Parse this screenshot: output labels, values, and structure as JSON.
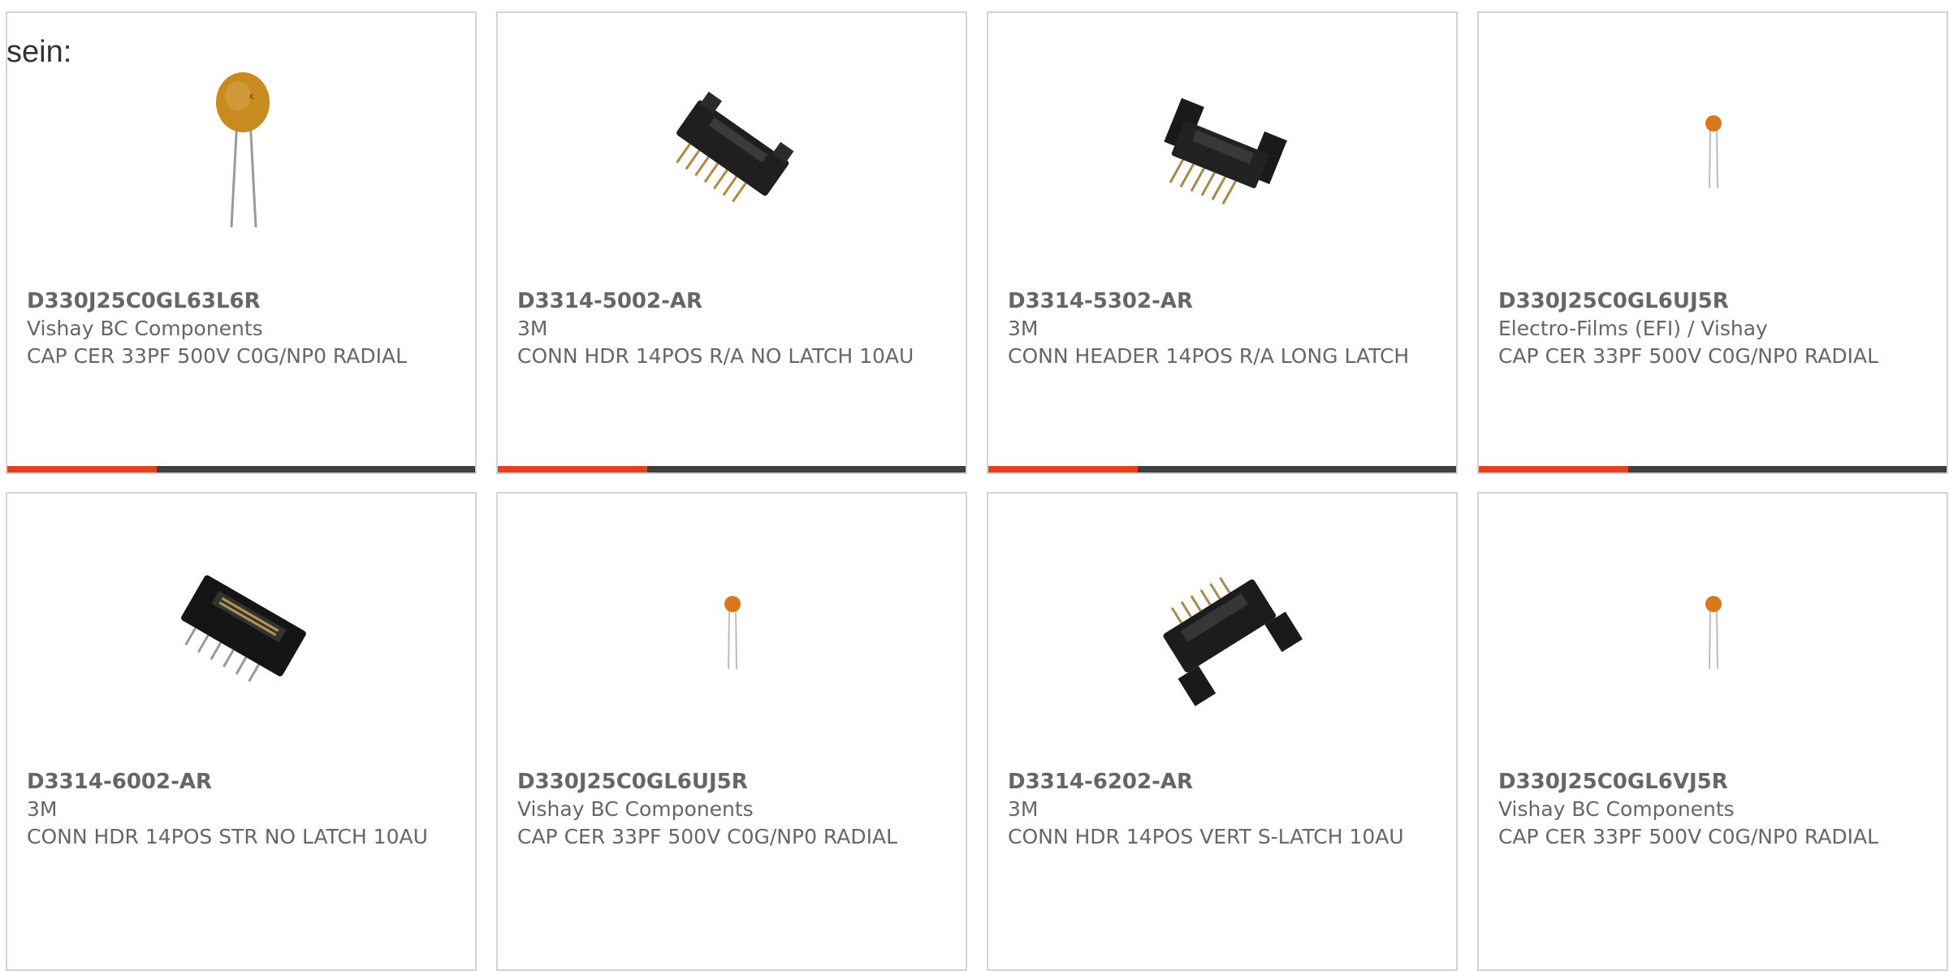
{
  "intro_text": "sein:",
  "colors": {
    "accent": "#e5411d",
    "bar": "#3f3f3f",
    "border": "#d4d4d4",
    "text": "#666666"
  },
  "products": [
    {
      "part_number": "D330J25C0GL63L6R",
      "manufacturer": "Vishay BC Components",
      "description": "CAP CER 33PF 500V C0G/NP0 RADIAL",
      "image": "ceramic-disc-capacitor-icon",
      "accent_fraction": 0.32
    },
    {
      "part_number": "D3314-5002-AR",
      "manufacturer": "3M",
      "description": "CONN HDR 14POS R/A NO LATCH 10AU",
      "image": "right-angle-header-icon",
      "accent_fraction": 0.32
    },
    {
      "part_number": "D3314-5302-AR",
      "manufacturer": "3M",
      "description": "CONN HEADER 14POS R/A LONG LATCH",
      "image": "latched-header-icon",
      "accent_fraction": 0.32
    },
    {
      "part_number": "D330J25C0GL6UJ5R",
      "manufacturer": "Electro-Films (EFI) / Vishay",
      "description": "CAP CER 33PF 500V C0G/NP0 RADIAL",
      "image": "small-disc-capacitor-icon",
      "accent_fraction": 0.32
    },
    {
      "part_number": "D3314-6002-AR",
      "manufacturer": "3M",
      "description": "CONN HDR 14POS STR NO LATCH 10AU",
      "image": "straight-header-icon",
      "accent_fraction": 0
    },
    {
      "part_number": "D330J25C0GL6UJ5R",
      "manufacturer": "Vishay BC Components",
      "description": "CAP CER 33PF 500V C0G/NP0 RADIAL",
      "image": "small-disc-capacitor-icon",
      "accent_fraction": 0
    },
    {
      "part_number": "D3314-6202-AR",
      "manufacturer": "3M",
      "description": "CONN HDR 14POS VERT S-LATCH 10AU",
      "image": "vertical-latch-header-icon",
      "accent_fraction": 0
    },
    {
      "part_number": "D330J25C0GL6VJ5R",
      "manufacturer": "Vishay BC Components",
      "description": "CAP CER 33PF 500V C0G/NP0 RADIAL",
      "image": "small-disc-capacitor-icon",
      "accent_fraction": 0
    }
  ]
}
